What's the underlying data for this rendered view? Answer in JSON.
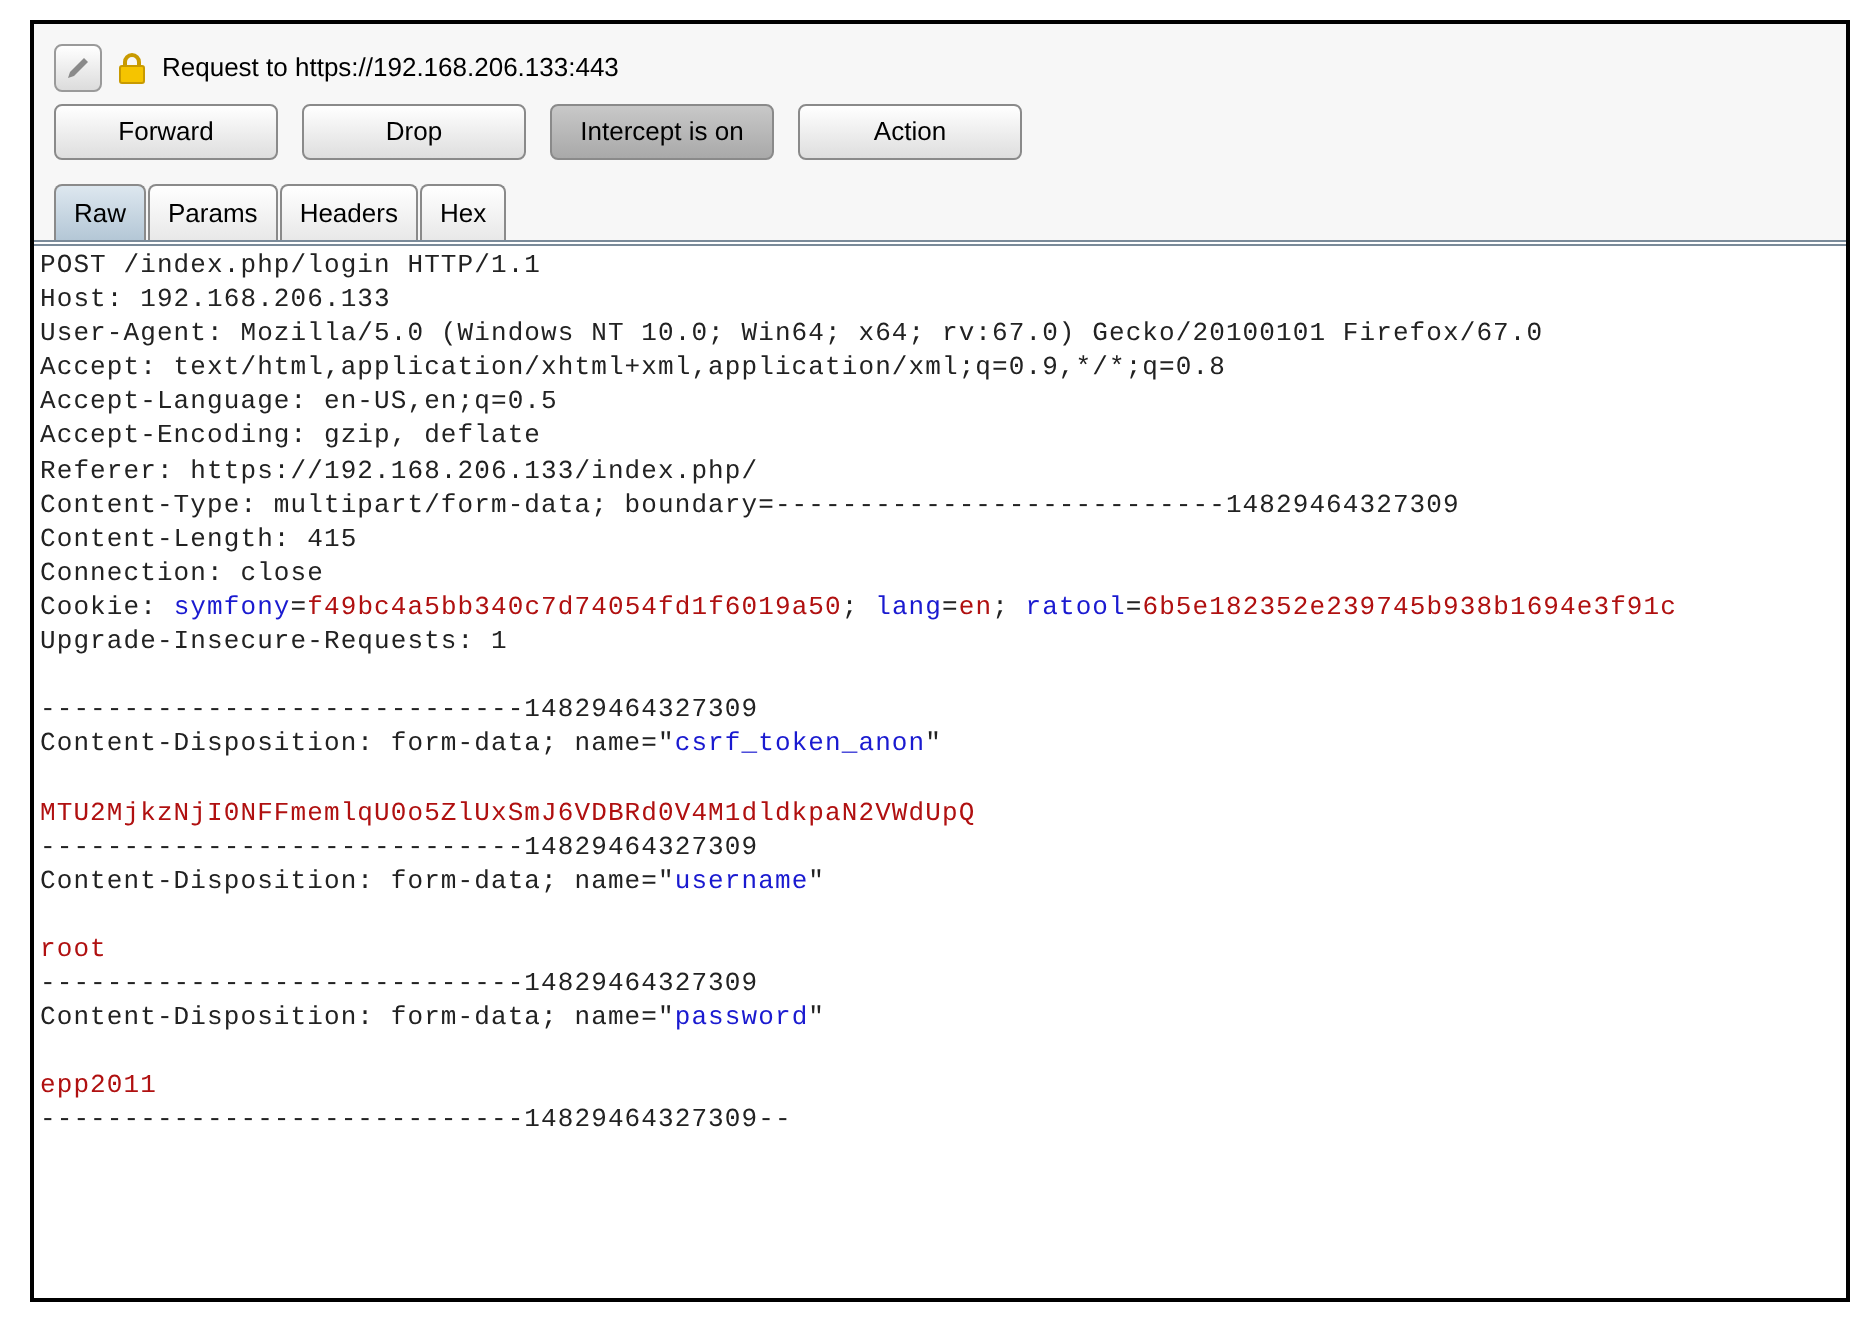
{
  "header": {
    "title": "Request to https://192.168.206.133:443"
  },
  "buttons": [
    {
      "label": "Forward",
      "pressed": false
    },
    {
      "label": "Drop",
      "pressed": false
    },
    {
      "label": "Intercept is on",
      "pressed": true
    },
    {
      "label": "Action",
      "pressed": false
    }
  ],
  "tabs": [
    {
      "label": "Raw",
      "selected": true
    },
    {
      "label": "Params",
      "selected": false
    },
    {
      "label": "Headers",
      "selected": false
    },
    {
      "label": "Hex",
      "selected": false
    }
  ],
  "lines": [
    {
      "kind": "text",
      "segments": [
        {
          "text": "POST /index.php/login HTTP/1.1",
          "kind": "plain"
        }
      ]
    },
    {
      "kind": "text",
      "segments": [
        {
          "text": "Host: 192.168.206.133",
          "kind": "plain"
        }
      ]
    },
    {
      "kind": "text",
      "segments": [
        {
          "text": "User-Agent: Mozilla/5.0 (Windows NT 10.0; Win64; x64; rv:67.0) Gecko/20100101 Firefox/67.0",
          "kind": "plain"
        }
      ]
    },
    {
      "kind": "text",
      "segments": [
        {
          "text": "Accept: text/html,application/xhtml+xml,application/xml;q=0.9,*/*;q=0.8",
          "kind": "plain"
        }
      ]
    },
    {
      "kind": "text",
      "segments": [
        {
          "text": "Accept-Language: en-US,en;q=0.5",
          "kind": "plain"
        }
      ]
    },
    {
      "kind": "text",
      "segments": [
        {
          "text": "Accept-Encoding: gzip, deflate",
          "kind": "plain"
        }
      ]
    },
    {
      "kind": "text",
      "segments": [
        {
          "text": "Referer: https://192.168.206.133/index.php/",
          "kind": "plain"
        }
      ]
    },
    {
      "kind": "text",
      "segments": [
        {
          "text": "Content-Type: multipart/form-data; boundary=---------------------------14829464327309",
          "kind": "plain"
        }
      ]
    },
    {
      "kind": "text",
      "segments": [
        {
          "text": "Content-Length: 415",
          "kind": "plain"
        }
      ]
    },
    {
      "kind": "text",
      "segments": [
        {
          "text": "Connection: close",
          "kind": "plain"
        }
      ]
    },
    {
      "kind": "text",
      "segments": [
        {
          "text": "Cookie: ",
          "kind": "plain"
        },
        {
          "text": "symfony",
          "kind": "name"
        },
        {
          "text": "=",
          "kind": "plain"
        },
        {
          "text": "f49bc4a5bb340c7d74054fd1f6019a50",
          "kind": "value"
        },
        {
          "text": "; ",
          "kind": "plain"
        },
        {
          "text": "lang",
          "kind": "name"
        },
        {
          "text": "=",
          "kind": "plain"
        },
        {
          "text": "en",
          "kind": "value"
        },
        {
          "text": "; ",
          "kind": "plain"
        },
        {
          "text": "ratool",
          "kind": "name"
        },
        {
          "text": "=",
          "kind": "plain"
        },
        {
          "text": "6b5e182352e239745b938b1694e3f91c",
          "kind": "value"
        }
      ]
    },
    {
      "kind": "text",
      "segments": [
        {
          "text": "Upgrade-Insecure-Requests: 1",
          "kind": "plain"
        }
      ]
    },
    {
      "kind": "blank"
    },
    {
      "kind": "text",
      "segments": [
        {
          "text": "-----------------------------14829464327309",
          "kind": "plain"
        }
      ]
    },
    {
      "kind": "text",
      "segments": [
        {
          "text": "Content-Disposition: form-data; name=\"",
          "kind": "plain"
        },
        {
          "text": "csrf_token_anon",
          "kind": "name"
        },
        {
          "text": "\"",
          "kind": "plain"
        }
      ]
    },
    {
      "kind": "blank"
    },
    {
      "kind": "text",
      "segments": [
        {
          "text": "MTU2MjkzNjI0NFFmemlqU0o5ZlUxSmJ6VDBRd0V4M1dldkpaN2VWdUpQ",
          "kind": "value"
        }
      ]
    },
    {
      "kind": "text",
      "segments": [
        {
          "text": "-----------------------------14829464327309",
          "kind": "plain"
        }
      ]
    },
    {
      "kind": "text",
      "segments": [
        {
          "text": "Content-Disposition: form-data; name=\"",
          "kind": "plain"
        },
        {
          "text": "username",
          "kind": "name"
        },
        {
          "text": "\"",
          "kind": "plain"
        }
      ]
    },
    {
      "kind": "blank"
    },
    {
      "kind": "text",
      "segments": [
        {
          "text": "root",
          "kind": "value"
        }
      ]
    },
    {
      "kind": "text",
      "segments": [
        {
          "text": "-----------------------------14829464327309",
          "kind": "plain"
        }
      ]
    },
    {
      "kind": "text",
      "segments": [
        {
          "text": "Content-Disposition: form-data; name=\"",
          "kind": "plain"
        },
        {
          "text": "password",
          "kind": "name"
        },
        {
          "text": "\"",
          "kind": "plain"
        }
      ]
    },
    {
      "kind": "blank"
    },
    {
      "kind": "text",
      "segments": [
        {
          "text": "epp2011",
          "kind": "value"
        }
      ]
    },
    {
      "kind": "text",
      "segments": [
        {
          "text": "-----------------------------14829464327309--",
          "kind": "plain"
        }
      ]
    }
  ]
}
